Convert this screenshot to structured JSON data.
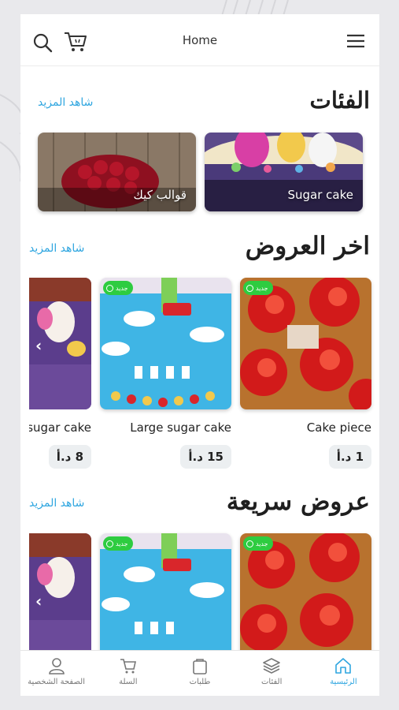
{
  "header": {
    "title": "Home"
  },
  "categories": {
    "title": "الفئات",
    "see_more": "شاهد المزيد",
    "items": [
      {
        "label": "Sugar cake"
      },
      {
        "label": "قوالب كيك"
      }
    ]
  },
  "latest_offers": {
    "title": "اخر العروض",
    "see_more": "شاهد المزيد",
    "badge": "جديد",
    "products": [
      {
        "name": "Cake piece",
        "price": "1 د.أ"
      },
      {
        "name": "Large sugar cake",
        "price": "15 د.أ"
      },
      {
        "name": "sugar cake",
        "price": "8 د.أ"
      }
    ]
  },
  "quick_offers": {
    "title": "عروض سريعة",
    "see_more": "شاهد المزيد",
    "badge": "جديد"
  },
  "bottom_nav": {
    "items": [
      {
        "label": "الصفحة الشخصية",
        "icon": "profile-icon"
      },
      {
        "label": "السلة",
        "icon": "cart-icon"
      },
      {
        "label": "طلبات",
        "icon": "orders-icon"
      },
      {
        "label": "الفئات",
        "icon": "layers-icon"
      },
      {
        "label": "الرئيسية",
        "icon": "home-icon"
      }
    ],
    "active_index": 4
  },
  "colors": {
    "accent": "#2fa6e0",
    "badge": "#2ecc40"
  }
}
